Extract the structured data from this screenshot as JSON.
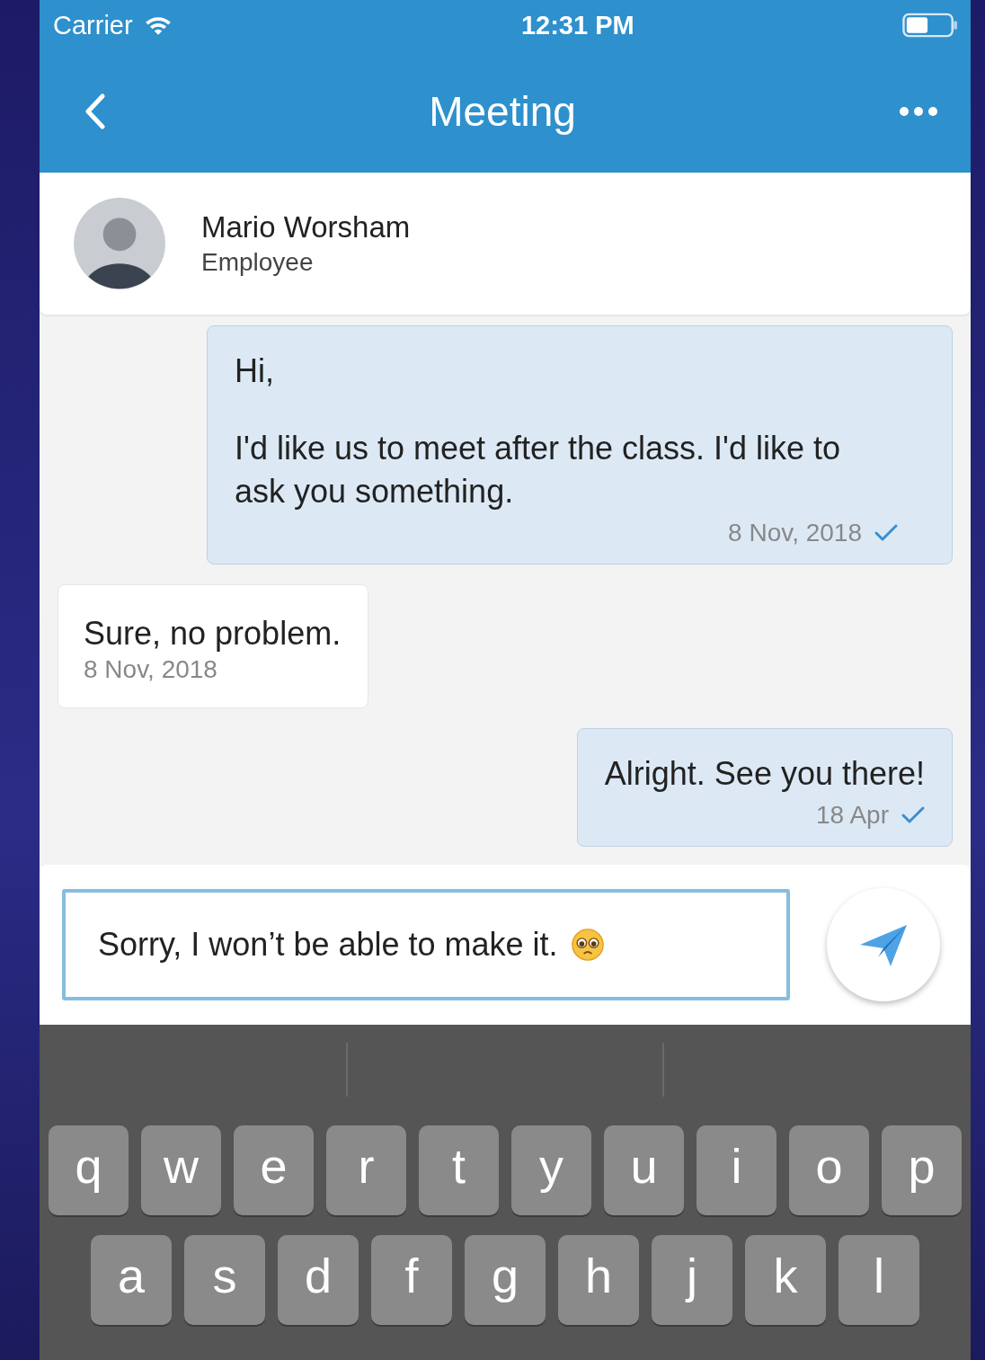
{
  "status_bar": {
    "carrier": "Carrier",
    "time": "12:31 PM"
  },
  "nav": {
    "title": "Meeting"
  },
  "contact": {
    "name": "Mario Worsham",
    "role": "Employee"
  },
  "messages": [
    {
      "kind": "outgoing",
      "lines": [
        "Hi,",
        "I'd like us to meet after the class. I'd like to ask you something."
      ],
      "time": "8 Nov, 2018",
      "delivered": true
    },
    {
      "kind": "incoming",
      "lines": [
        "Sure, no problem."
      ],
      "time": "8 Nov, 2018",
      "delivered": false
    },
    {
      "kind": "outgoing",
      "lines": [
        "Alright. See you there!"
      ],
      "time": "18 Apr",
      "delivered": true
    }
  ],
  "composer": {
    "value": "Sorry, I won’t be able to make it."
  },
  "keyboard": {
    "rows": [
      [
        "q",
        "w",
        "e",
        "r",
        "t",
        "y",
        "u",
        "i",
        "o",
        "p"
      ],
      [
        "a",
        "s",
        "d",
        "f",
        "g",
        "h",
        "j",
        "k",
        "l"
      ]
    ]
  }
}
